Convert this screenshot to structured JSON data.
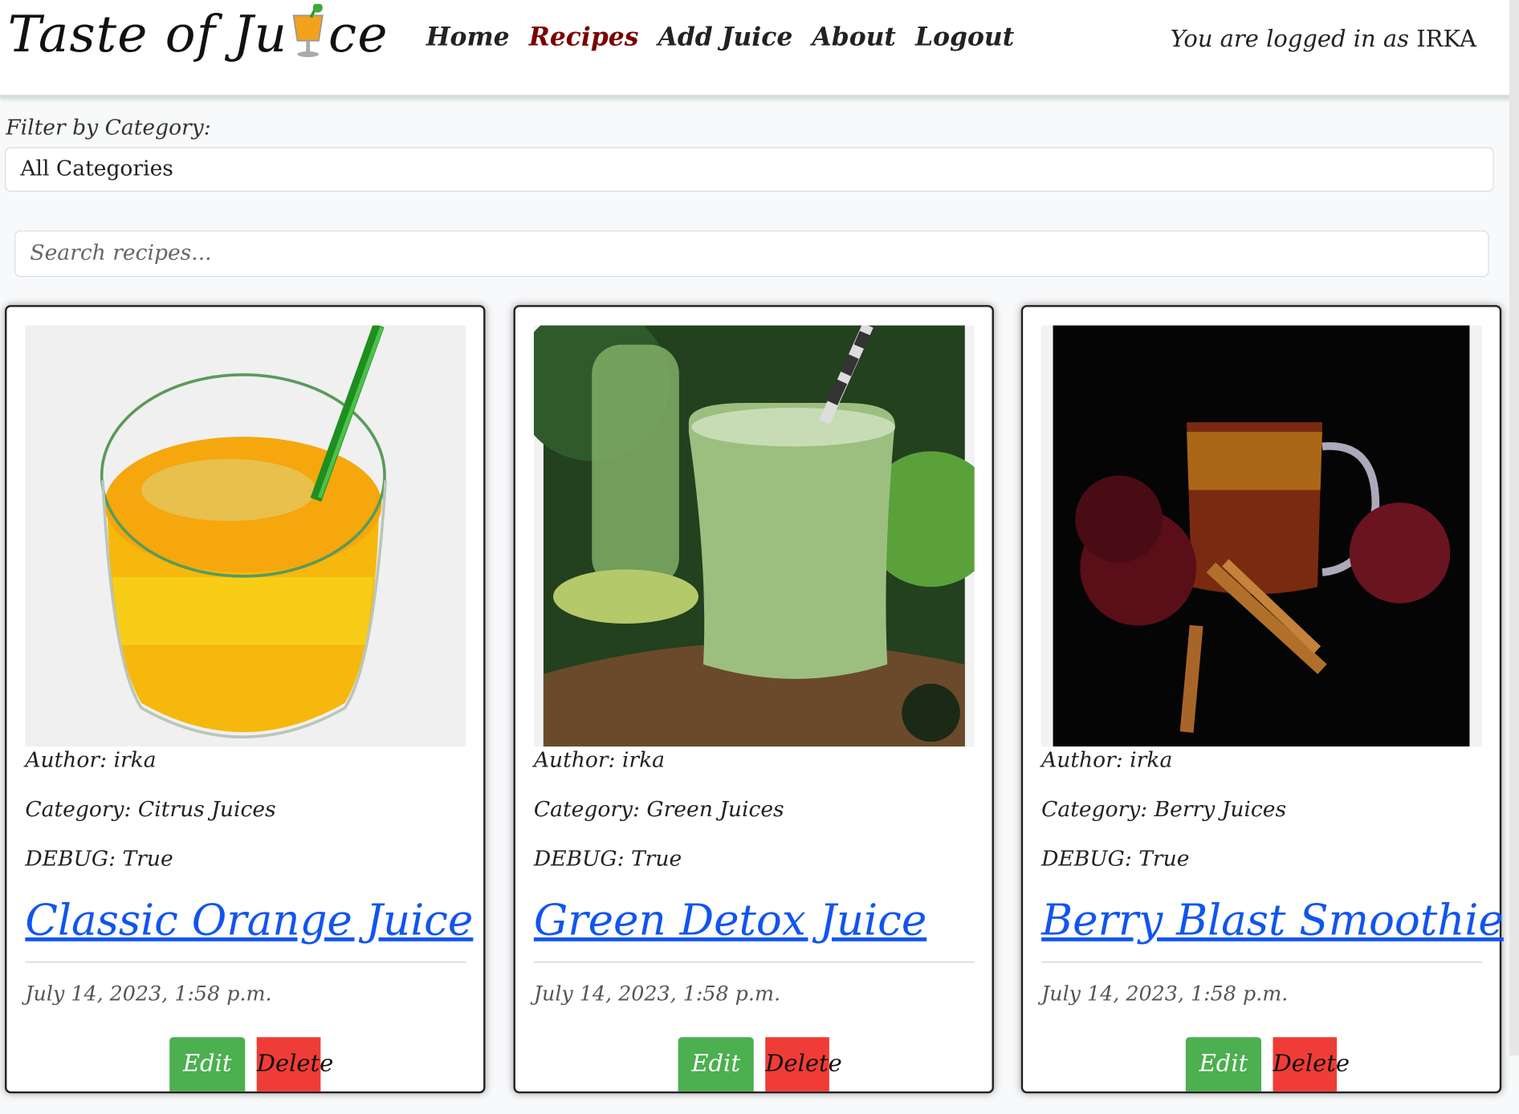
{
  "header": {
    "brand_part1": "Taste of Ju",
    "brand_part2": "ce",
    "nav": [
      {
        "label": "Home"
      },
      {
        "label": "Recipes"
      },
      {
        "label": "Add Juice"
      },
      {
        "label": "About"
      },
      {
        "label": "Logout"
      }
    ],
    "login_prefix": "You are logged in as",
    "username": "IRKA"
  },
  "filter": {
    "label": "Filter by Category:",
    "selected": "All Categories"
  },
  "search": {
    "placeholder": "Search recipes..."
  },
  "cards": [
    {
      "image": "orange-juice-illustration",
      "author": "Author: irka",
      "category": "Category: Citrus Juices",
      "debug": "DEBUG: True",
      "title": "Classic Orange Juice",
      "date": "July 14, 2023, 1:58 p.m.",
      "edit": "Edit",
      "delete": "Delete"
    },
    {
      "image": "green-smoothie-photo",
      "author": "Author: irka",
      "category": "Category: Green Juices",
      "debug": "DEBUG: True",
      "title": "Green Detox Juice",
      "date": "July 14, 2023, 1:58 p.m.",
      "edit": "Edit",
      "delete": "Delete"
    },
    {
      "image": "berry-juice-apples-photo",
      "author": "Author: irka",
      "category": "Category: Berry Juices",
      "debug": "DEBUG: True",
      "title": "Berry Blast Smoothie",
      "date": "July 14, 2023, 1:58 p.m.",
      "edit": "Edit",
      "delete": "Delete"
    }
  ],
  "colors": {
    "active_nav": "#7a0000",
    "link": "#1155ee",
    "edit_btn": "#4caf50",
    "delete_btn": "#f03c36"
  }
}
